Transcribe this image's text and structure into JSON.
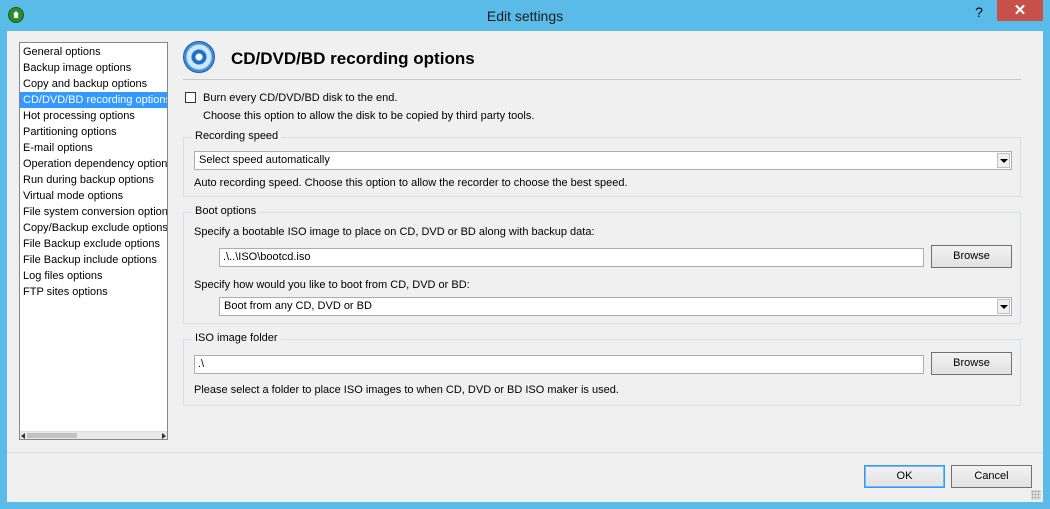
{
  "window": {
    "title": "Edit settings",
    "help_label": "?",
    "close_label": "✕"
  },
  "nav": {
    "items": [
      "General options",
      "Backup image options",
      "Copy and backup options",
      "CD/DVD/BD recording options",
      "Hot processing options",
      "Partitioning options",
      "E-mail options",
      "Operation dependency options",
      "Run during backup options",
      "Virtual mode options",
      "File system conversion options",
      "Copy/Backup exclude options",
      "File Backup exclude options",
      "File Backup include options",
      "Log files options",
      "FTP sites options"
    ],
    "selected_index": 3
  },
  "page": {
    "title": "CD/DVD/BD recording options",
    "burn_checkbox": {
      "label": "Burn every CD/DVD/BD disk to the end.",
      "checked": false,
      "hint": "Choose this option to allow the disk to be copied by third party tools."
    },
    "recording_speed": {
      "legend": "Recording speed",
      "selected": "Select speed automatically",
      "hint": "Auto recording speed. Choose this option to allow the recorder to choose the best speed."
    },
    "boot_options": {
      "legend": "Boot options",
      "iso_label": "Specify a bootable ISO image to place on CD, DVD or BD along with backup data:",
      "iso_value": ".\\..\\ISO\\bootcd.iso",
      "browse_label": "Browse",
      "boot_label": "Specify how would you like to boot from CD, DVD or BD:",
      "boot_selected": "Boot from any CD, DVD or BD"
    },
    "iso_folder": {
      "legend": "ISO image folder",
      "value": ".\\",
      "browse_label": "Browse",
      "hint": "Please select a folder to place ISO images to when CD, DVD or BD ISO maker is used."
    }
  },
  "footer": {
    "ok_label": "OK",
    "cancel_label": "Cancel"
  },
  "colors": {
    "titlebar": "#5bbbe8",
    "close_button": "#c7504b",
    "selection": "#3399ff"
  }
}
